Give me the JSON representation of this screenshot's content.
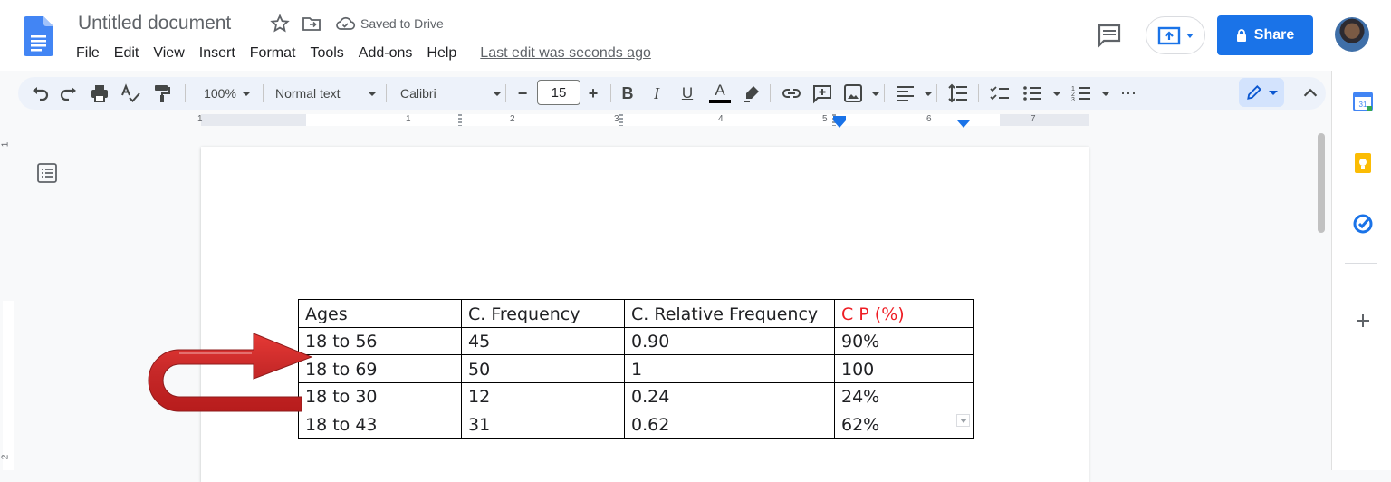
{
  "header": {
    "doc_title": "Untitled document",
    "saved_status": "Saved to Drive",
    "last_edit": "Last edit was seconds ago",
    "share_label": "Share",
    "menus": [
      "File",
      "Edit",
      "View",
      "Insert",
      "Format",
      "Tools",
      "Add-ons",
      "Help"
    ]
  },
  "toolbar": {
    "zoom": "100%",
    "style": "Normal text",
    "font": "Calibri",
    "font_size": "15",
    "minus": "−",
    "plus": "+",
    "more": "⋯"
  },
  "ruler": {
    "numbers": [
      "1",
      "1",
      "2",
      "3",
      "4",
      "5",
      "6",
      "7"
    ]
  },
  "vertical_ruler": {
    "numbers": [
      "1",
      "2"
    ]
  },
  "table": {
    "header": [
      "Ages",
      "C. Frequency",
      "C. Relative Frequency",
      "C P (%)"
    ],
    "rows": [
      [
        "18 to 56",
        "45",
        "0.90",
        "90%"
      ],
      [
        "18 to 69",
        "50",
        "1",
        "100"
      ],
      [
        "18 to 30",
        "12",
        "0.24",
        "24%"
      ],
      [
        "18 to 43",
        "31",
        "0.62",
        "62%"
      ]
    ]
  },
  "side_panel": {
    "calendar_day": "31"
  },
  "colors": {
    "accent": "#1a73e8",
    "highlight_header": "#ee1d24",
    "arrow": "#d32f2f"
  }
}
